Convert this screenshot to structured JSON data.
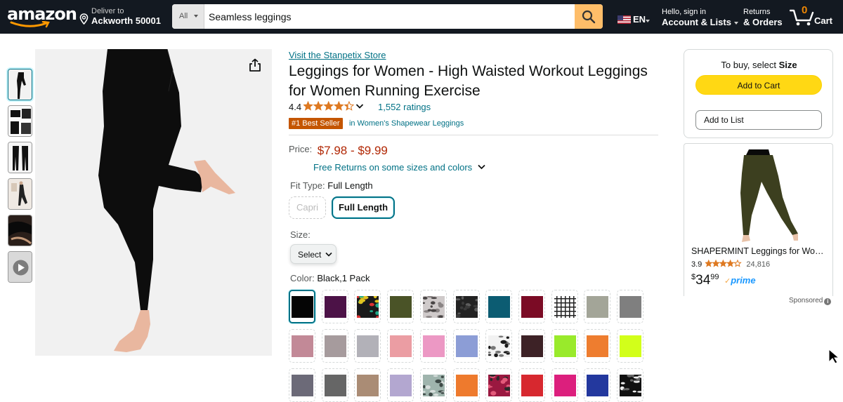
{
  "nav": {
    "logo": "amazon",
    "deliver_to_label": "Deliver to",
    "deliver_to_location": "Ackworth 50001",
    "search": {
      "category": "All",
      "value": "Seamless leggings"
    },
    "language": "EN",
    "account_line1": "Hello, sign in",
    "account_line2": "Account & Lists",
    "returns_line1": "Returns",
    "returns_line2": "& Orders",
    "cart_count": "0",
    "cart_label": "Cart",
    "colors": {
      "bg": "#131921",
      "search_button": "#febd69",
      "cart_count": "#f08804"
    }
  },
  "thumbnails": [
    "model-leg-raised",
    "waistband-closeup",
    "front-back-view",
    "lifestyle-photo",
    "fabric-detail",
    "video"
  ],
  "product": {
    "store_link": "Visit the Stanpetix Store",
    "title": "Leggings for Women - High Waisted Workout Leggings for Women Running Exercise",
    "rating": "4.4",
    "rating_stars": 4.4,
    "ratings_count": "1,552 ratings",
    "best_seller_badge": "#1 Best Seller",
    "best_seller_category": "in Women's Shapewear Leggings",
    "price_label": "Price:",
    "price_range": "$7.98 - $9.99",
    "free_returns": "Free Returns on some sizes and colors",
    "fit_type_label": "Fit Type:",
    "fit_type_value": "Full Length",
    "fit_options": [
      {
        "label": "Capri",
        "available": false
      },
      {
        "label": "Full Length",
        "selected": true
      }
    ],
    "size_label": "Size:",
    "size_select": "Select",
    "color_label": "Color:",
    "color_value": "Black,1 Pack",
    "swatches": [
      [
        "#050505",
        "#4c1247",
        "pattern-multicolor",
        "#4a5327",
        "pattern-leopard",
        "pattern-dark-camo",
        "#0c5c72",
        "#7b0b25",
        "pattern-plaid",
        "#a3a598",
        "#7f7f7f"
      ],
      [
        "#c28997",
        "#a69b9d",
        "#b2b1b8",
        "#eb9da3",
        "#ec98c4",
        "#8c9dd6",
        "pattern-zebra",
        "#3d2226",
        "#99ea2b",
        "#ee7d2f",
        "#d2ff1a"
      ],
      [
        "#6c6a78",
        "#666666",
        "#aa8c75",
        "#b3a7d0",
        "pattern-snake",
        "#ee7a2d",
        "pattern-tropical",
        "#d7282f",
        "#dc1f7d",
        "#23389e",
        "pattern-floral"
      ]
    ]
  },
  "buy_box": {
    "to_buy_text": "To buy, select",
    "to_buy_bold": "Size",
    "add_to_cart": "Add to Cart",
    "add_to_list": "Add to List"
  },
  "ad": {
    "title": "SHAPERMINT Leggings for Wom...",
    "rating": "3.9",
    "rating_stars": 3.9,
    "reviews": "24,816",
    "price_symbol": "$",
    "price_whole": "34",
    "price_fraction": "99",
    "prime": "prime",
    "sponsored": "Sponsored",
    "product_color": "#3c3f1f"
  }
}
